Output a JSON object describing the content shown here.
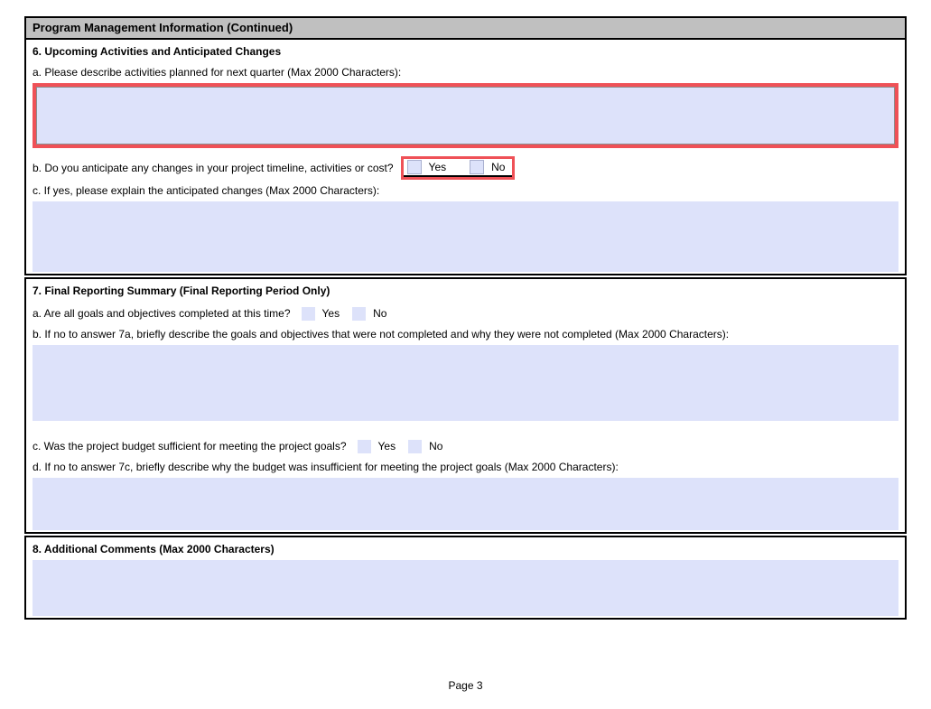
{
  "colors": {
    "highlight_red": "#ef5157",
    "field_blue": "#dde2fa",
    "header_gray": "#c0c0c0"
  },
  "header": {
    "title": "Program Management Information (Continued)"
  },
  "section6": {
    "title": "6. Upcoming Activities and Anticipated Changes",
    "q_a": {
      "label": "a. Please describe activities planned for next quarter (Max 2000 Characters):",
      "value": ""
    },
    "q_b": {
      "label": "b. Do you anticipate any changes in your project timeline, activities or cost?",
      "yes_label": "Yes",
      "no_label": "No"
    },
    "q_c": {
      "label": "c. If yes, please explain the anticipated changes (Max 2000 Characters):",
      "value": ""
    }
  },
  "section7": {
    "title": "7. Final Reporting Summary (Final Reporting Period Only)",
    "q_a": {
      "label": "a. Are all goals and objectives completed at this time?",
      "yes_label": "Yes",
      "no_label": "No"
    },
    "q_b": {
      "label": "b. If no to answer 7a, briefly describe the goals and objectives that were not completed and why they were not completed (Max 2000 Characters):",
      "value": ""
    },
    "q_c": {
      "label": "c. Was the project budget sufficient for meeting the project goals?",
      "yes_label": "Yes",
      "no_label": "No"
    },
    "q_d": {
      "label": "d. If no to answer 7c, briefly describe why the budget was insufficient for meeting the project goals (Max 2000 Characters):",
      "value": ""
    }
  },
  "section8": {
    "title": "8. Additional Comments (Max 2000 Characters)",
    "value": ""
  },
  "footer": {
    "page": "Page 3"
  }
}
